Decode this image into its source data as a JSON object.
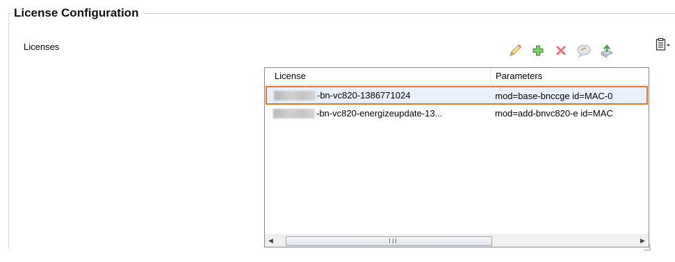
{
  "group": {
    "title": "License Configuration"
  },
  "field": {
    "label": "Licenses"
  },
  "toolbar": {
    "buttons": [
      {
        "name": "edit",
        "icon": "pencil-icon",
        "color": "#c8a24a"
      },
      {
        "name": "add",
        "icon": "plus-icon",
        "color": "#4aa84a"
      },
      {
        "name": "delete",
        "icon": "x-icon",
        "color": "#e06060"
      },
      {
        "name": "comment",
        "icon": "speech-bubble-icon",
        "color": "#b7bfc9"
      },
      {
        "name": "upload",
        "icon": "upload-icon",
        "color": "#5aa05a"
      }
    ],
    "menu_icon": "clipboard-dropdown-icon"
  },
  "list": {
    "columns": {
      "license": "License",
      "parameters": "Parameters"
    },
    "rows": [
      {
        "license": "-bn-vc820-1386771024",
        "parameters": "mod=base-bnccge id=MAC-0",
        "selected": true
      },
      {
        "license": "-bn-vc820-energizeupdate-13...",
        "parameters": "mod=add-bnvc820-e id=MAC",
        "selected": false
      }
    ],
    "scroll_glyph": "III",
    "selection_color": "#e8761c"
  }
}
